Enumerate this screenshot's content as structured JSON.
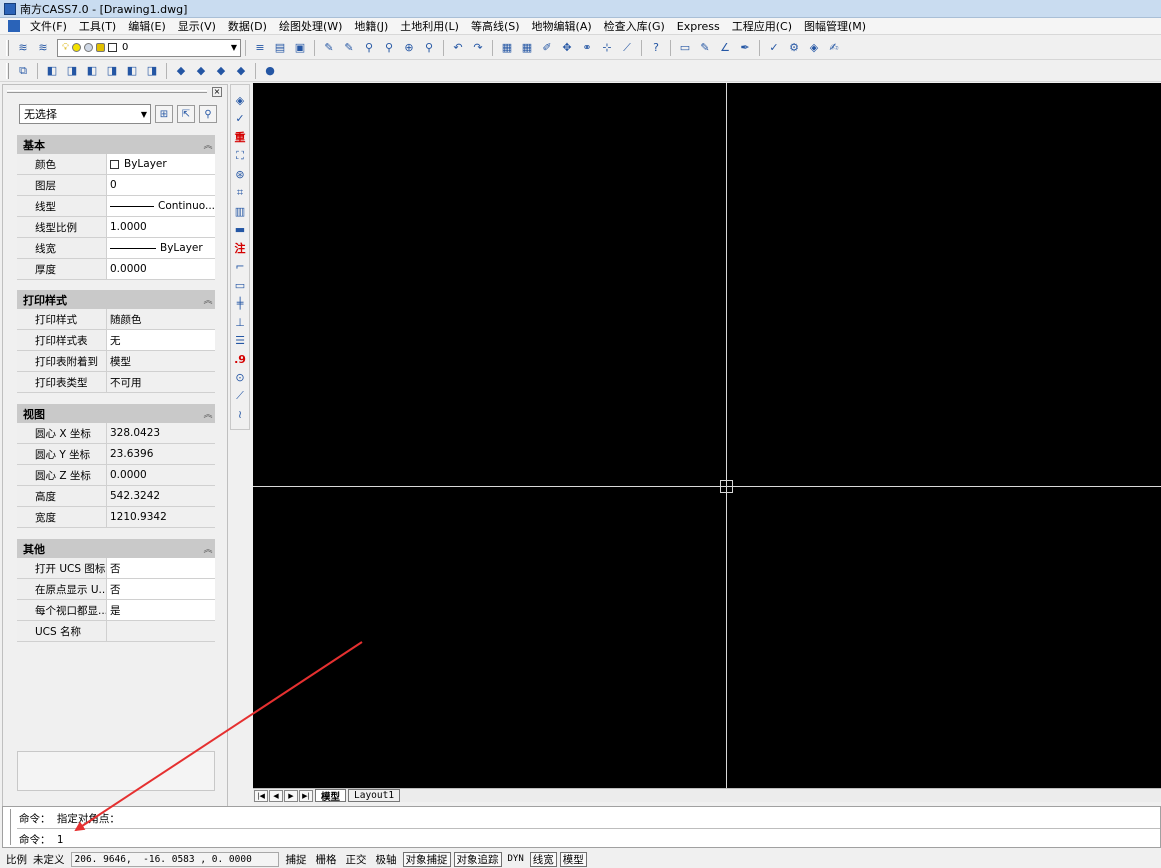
{
  "window": {
    "title": "南方CASS7.0 - [Drawing1.dwg]"
  },
  "menubar": {
    "items": [
      "文件(F)",
      "工具(T)",
      "编辑(E)",
      "显示(V)",
      "数据(D)",
      "绘图处理(W)",
      "地籍(J)",
      "土地利用(L)",
      "等高线(S)",
      "地物编辑(A)",
      "检查入库(G)",
      "Express",
      "工程应用(C)",
      "图幅管理(M)"
    ]
  },
  "toolbar": {
    "layer_value": "0"
  },
  "properties": {
    "selection": "无选择",
    "sections": [
      {
        "title": "基本",
        "rows": [
          {
            "name": "颜色",
            "value": "ByLayer"
          },
          {
            "name": "图层",
            "value": "0"
          },
          {
            "name": "线型",
            "value": "Continuo..."
          },
          {
            "name": "线型比例",
            "value": "1.0000"
          },
          {
            "name": "线宽",
            "value": "ByLayer"
          },
          {
            "name": "厚度",
            "value": "0.0000"
          }
        ]
      },
      {
        "title": "打印样式",
        "rows": [
          {
            "name": "打印样式",
            "value": "随颜色"
          },
          {
            "name": "打印样式表",
            "value": "无"
          },
          {
            "name": "打印表附着到",
            "value": "模型"
          },
          {
            "name": "打印表类型",
            "value": "不可用"
          }
        ]
      },
      {
        "title": "视图",
        "rows": [
          {
            "name": "圆心 X 坐标",
            "value": "328.0423"
          },
          {
            "name": "圆心 Y 坐标",
            "value": "23.6396"
          },
          {
            "name": "圆心 Z 坐标",
            "value": "0.0000"
          },
          {
            "name": "高度",
            "value": "542.3242"
          },
          {
            "name": "宽度",
            "value": "1210.9342"
          }
        ]
      },
      {
        "title": "其他",
        "rows": [
          {
            "name": "打开 UCS 图标",
            "value": "否"
          },
          {
            "name": "在原点显示 U...",
            "value": "否"
          },
          {
            "name": "每个视口都显...",
            "value": "是"
          },
          {
            "name": "UCS 名称",
            "value": ""
          }
        ]
      }
    ]
  },
  "vertical_toolbar": {
    "label_zhong": "重",
    "label_zhu": "注",
    "label_dot9": ".9"
  },
  "tabs": {
    "model": "模型",
    "layout1": "Layout1"
  },
  "command": {
    "line1": "命令： 指定对角点：",
    "line2": "命令： 1"
  },
  "status": {
    "scale_label": "比例",
    "scale_value": "未定义",
    "coords": "206. 9646,  -16. 0583 , 0. 0000",
    "buttons": [
      "捕捉",
      "栅格",
      "正交",
      "极轴",
      "对象捕捉",
      "对象追踪",
      "DYN",
      "线宽",
      "模型"
    ]
  },
  "annotation": {
    "color": "#e53030"
  }
}
